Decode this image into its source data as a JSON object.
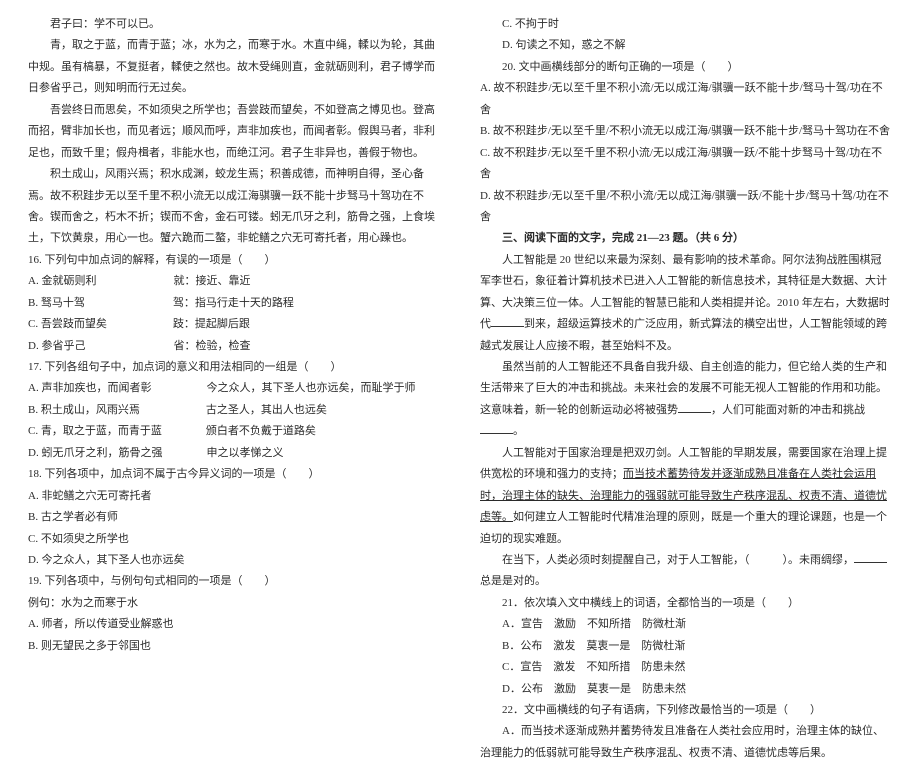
{
  "left": {
    "p1": "君子曰：学不可以已。",
    "p2": "青，取之于蓝，而青于蓝；冰，水为之，而寒于水。木直中绳，輮以为轮，其曲中规。虽有槁暴，不复挺者，輮使之然也。故木受绳则直，金就砺则利，君子博学而日参省乎己，则知明而行无过矣。",
    "p3": "吾尝终日而思矣，不如须臾之所学也；吾尝跂而望矣，不如登高之博见也。登高而招，臂非加长也，而见者远；顺风而呼，声非加疾也，而闻者彰。假舆马者，非利足也，而致千里；假舟楫者，非能水也，而绝江河。君子生非异也，善假于物也。",
    "p4": "积土成山，风雨兴焉；积水成渊，蛟龙生焉；积善成德，而神明自得，圣心备焉。故不积跬步无以至千里不积小流无以成江海骐骥一跃不能十步驽马十驾功在不舍。锲而舍之，朽木不折；锲而不舍，金石可镂。蚓无爪牙之利，筋骨之强，上食埃土，下饮黄泉，用心一也。蟹六跪而二螯，非蛇鳝之穴无可寄托者，用心躁也。",
    "q16": "16. 下列句中加点词的解释，有误的一项是（　　）",
    "q16a": "A. 金就砺则利　　　　　　　就：接近、靠近",
    "q16b": "B. 驽马十驾　　　　　　　　驾：指马行走十天的路程",
    "q16c": "C. 吾尝跂而望矣　　　　　　跂：提起脚后跟",
    "q16d": "D. 参省乎己　　　　　　　　省：检验，检查",
    "q17": "17. 下列各组句子中，加点词的意义和用法相同的一组是（　　）",
    "q17a": "A. 声非加疾也，而闻者彰　　　　　今之众人，其下圣人也亦远矣，而耻学于师",
    "q17b": "B. 积土成山，风雨兴焉　　　　　　古之圣人，其出人也远矣",
    "q17c": "C. 青，取之于蓝，而青于蓝　　　　颁白者不负戴于道路矣",
    "q17d": "D. 蚓无爪牙之利，筋骨之强　　　　申之以孝悌之义",
    "q18": "18. 下列各项中，加点词不属于古今异义词的一项是（　　）",
    "q18a": "A. 非蛇鳝之穴无可寄托者",
    "q18b": "B. 古之学者必有师",
    "q18c": "C. 不如须臾之所学也",
    "q18d": "D. 今之众人，其下圣人也亦远矣",
    "q19": "19. 下列各项中，与例句句式相同的一项是（　　）",
    "q19e": "例句：水为之而寒于水",
    "q19a": "A. 师者，所以传道受业解惑也",
    "q19b": "B. 则无望民之多于邻国也"
  },
  "right": {
    "q19c": "C. 不拘于时",
    "q19d": "D. 句读之不知，惑之不解",
    "q20": "20. 文中画横线部分的断句正确的一项是（　　）",
    "q20a": "A. 故不积跬步/无以至千里不积小流/无以成江海/骐骥一跃不能十步/驽马十驾/功在不舍",
    "q20b": "B. 故不积跬步/无以至千里/不积小流无以成江海/骐骥一跃不能十步/驽马十驾功在不舍",
    "q20c": "C. 故不积跬步/无以至千里不积小流/无以成江海/骐骥一跃/不能十步驽马十驾/功在不舍",
    "q20d": "D. 故不积跬步/无以至千里/不积小流/无以成江海/骐骥一跃/不能十步/驽马十驾/功在不舍",
    "h3": "三、阅读下面的文字，完成 21—23 题。（共 6 分）",
    "p5a": "人工智能是 20 世纪以来最为深刻、最有影响的技术革命。阿尔法狗战胜围棋冠军李世石，象征着计算机技术已进入人工智能的新信息技术，其特征是大数据、大计算、大决策三位一体。人工智能的智慧已能和人类相提并论。2010 年左右，大数据时代",
    "p5b": "到来，超级运算技术的广泛应用，新式算法的横空出世，人工智能领域的跨越式发展让人应接不暇，甚至始料不及。",
    "p6a": "虽然当前的人工智能还不具备自我升级、自主创造的能力，但它给人类的生产和生活带来了巨大的冲击和挑战。未来社会的发展不可能无视人工智能的作用和功能。这意味着，新一轮的创新运动必将被强势",
    "p6b": "，人们可能面对新的冲击和挑战",
    "p6c": "。",
    "p7a": "人工智能对于国家治理是把双刃剑。人工智能的早期发展，需要国家在治理上提供宽松的环境和强力的支持；",
    "p7b": "而当技术蓄势待发并逐渐成熟且准备在人类社会运用时，治理主体的缺失、治理能力的强弱就可能导致生产秩序混乱、权责不清、道德忧虑等。",
    "p7c": "如何建立人工智能时代精准治理的原则，既是一个重大的理论课题，也是一个迫切的现实难题。",
    "p8a": "在当下，人类必须时刻提醒自己，对于人工智能，（　　　）。未雨绸缪，",
    "p8b": "总是是对的。",
    "q21": "21．依次填入文中横线上的词语，全都恰当的一项是（　　）",
    "q21a": "A．宣告　激励　不知所措　防微杜渐",
    "q21b": "B．公布　激发　莫衷一是　防微杜渐",
    "q21c": "C．宣告　激发　不知所措　防患未然",
    "q21d": "D．公布　激励　莫衷一是　防患未然",
    "q22": "22．文中画横线的句子有语病，下列修改最恰当的一项是（　　）",
    "q22a": "A．而当技术逐渐成熟并蓄势待发且准备在人类社会应用时，治理主体的缺位、治理能力的低弱就可能导致生产秩序混乱、权责不清、道德忧虑等后果。"
  }
}
